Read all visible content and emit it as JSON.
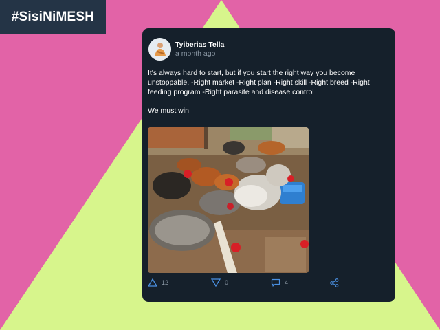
{
  "brand": {
    "hashtag": "#SisiNiMESH"
  },
  "post": {
    "author": "Tyiberias Tella",
    "time": "a month ago",
    "text": "It's always hard to start, but if you start the right way you become unstoppable. -Right market -Right plan -Right skill -Right breed -Right feeding program -Right parasite and disease control",
    "text2": "We must win"
  },
  "actions": {
    "upvote_count": "12",
    "downvote_count": "0",
    "comment_count": "4"
  },
  "icons": [
    "upvote-icon",
    "downvote-icon",
    "comment-icon",
    "share-icon"
  ],
  "colors": {
    "background": "#e263a7",
    "triangle": "#d7f58c",
    "card": "#15202b",
    "tab": "#243446",
    "accent": "#4a90e2"
  }
}
